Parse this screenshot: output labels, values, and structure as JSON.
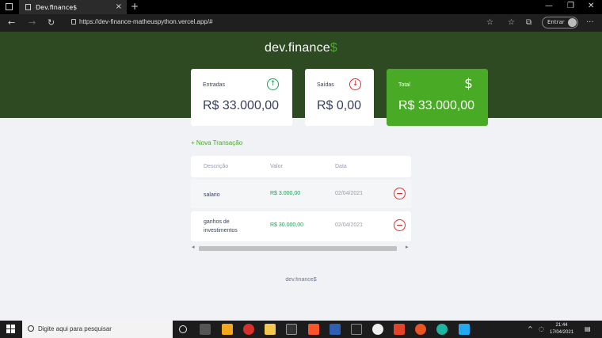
{
  "browser": {
    "tab_title": "Dev.finance$",
    "tab_close": "×",
    "new_tab": "+",
    "url": "https://dev-finance-matheuspython.vercel.app/#",
    "signin_label": "Entrar",
    "controls": {
      "minimize": "—",
      "restore": "❐",
      "close": "✕"
    },
    "nav": {
      "back": "←",
      "forward": "→",
      "reload": "↻"
    },
    "tools": {
      "favorite": "☆",
      "favorites": "☆",
      "collections": "⧉",
      "more": "···"
    }
  },
  "header": {
    "logo_text": "dev.finance",
    "logo_dollar": "$"
  },
  "cards": {
    "income": {
      "label": "Entradas",
      "value": "R$ 33.000,00",
      "icon": "↑"
    },
    "expense": {
      "label": "Saídas",
      "value": "R$ 0,00",
      "icon": "↓"
    },
    "total": {
      "label": "Total",
      "value": "R$ 33.000,00",
      "icon": "$"
    }
  },
  "new_transaction_label": "+ Nova Transação",
  "table": {
    "headers": [
      "Descrição",
      "Valor",
      "Data"
    ],
    "rows": [
      {
        "description": "salario",
        "amount": "R$ 3.000,00",
        "date": "02/04/2021"
      },
      {
        "description": "ganhos de investimentos",
        "amount": "R$ 30.000,00",
        "date": "02/04/2021"
      }
    ]
  },
  "footer_text": "dev.finance$",
  "taskbar": {
    "search_placeholder": "Digite aqui para pesquisar",
    "time": "21:44",
    "date": "17/04/2021"
  },
  "colors": {
    "hero": "#2d4a22",
    "accent_green": "#49aa26",
    "income_green": "#12a454",
    "expense_red": "#e92929"
  }
}
